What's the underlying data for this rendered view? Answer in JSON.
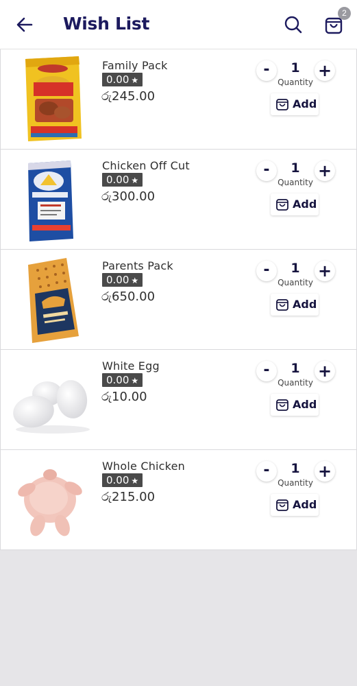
{
  "header": {
    "title": "Wish List",
    "cart_count": "2",
    "back_icon": "arrow-left-icon",
    "search_icon": "search-icon",
    "cart_icon": "shopping-bag-icon"
  },
  "colors": {
    "primary": "#1c1a5e",
    "rating_bg": "#4a4a4a",
    "page_bg": "#e6e5e8",
    "badge": "#9a9aa0"
  },
  "labels": {
    "quantity": "Quantity",
    "add": "Add",
    "minus": "-",
    "plus": "+",
    "star": "★"
  },
  "items": [
    {
      "name": "Family Pack",
      "rating": "0.00",
      "price": "රු245.00",
      "quantity": "1",
      "image": "chicken-family-pack-image"
    },
    {
      "name": "Chicken Off Cut",
      "rating": "0.00",
      "price": "රු300.00",
      "quantity": "1",
      "image": "chicken-off-cut-image"
    },
    {
      "name": "Parents Pack",
      "rating": "0.00",
      "price": "රු650.00",
      "quantity": "1",
      "image": "parents-pack-image"
    },
    {
      "name": "White Egg",
      "rating": "0.00",
      "price": "රු10.00",
      "quantity": "1",
      "image": "white-eggs-image"
    },
    {
      "name": "Whole Chicken",
      "rating": "0.00",
      "price": "රු215.00",
      "quantity": "1",
      "image": "whole-chicken-image"
    }
  ]
}
